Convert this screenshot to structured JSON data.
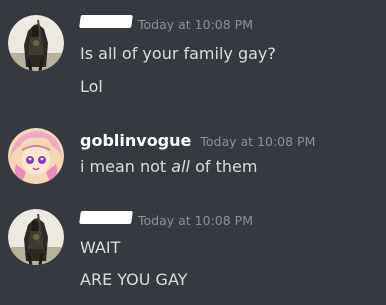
{
  "messages": [
    {
      "author": "",
      "author_redacted": true,
      "timestamp": "Today at 10:08 PM",
      "lines": [
        "Is all of your family gay?",
        "Lol"
      ]
    },
    {
      "author": "goblinvogue",
      "author_redacted": false,
      "timestamp": "Today at 10:08 PM",
      "lines": [
        "i mean not ",
        "all",
        " of them"
      ]
    },
    {
      "author": "",
      "author_redacted": true,
      "timestamp": "Today at 10:08 PM",
      "lines": [
        "WAIT",
        "ARE YOU GAY"
      ]
    }
  ],
  "colors": {
    "background": "#36393f",
    "username": "#ffffff",
    "timestamp": "#8e9297",
    "message_text": "#dcddde"
  }
}
